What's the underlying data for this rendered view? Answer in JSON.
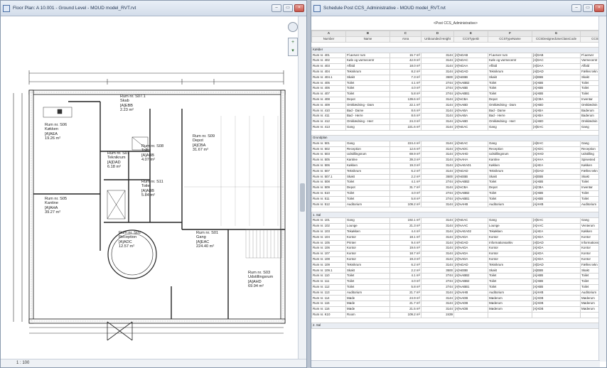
{
  "left_window": {
    "title": "Floor Plan: A 10.001 - Ground Level - MOUD model_RVT.rvt",
    "status_text": "1 : 100"
  },
  "right_window": {
    "title": "Schedule Post CCS_Administrative - MOUD model_RVT.rvt"
  },
  "window_buttons": {
    "minimize": "–",
    "restore": "▭",
    "close": "×"
  },
  "floor_plan": {
    "rooms": [
      {
        "label": "Rum nr. S07.1\nSkab\n[A]EBB\n2.23 m²"
      },
      {
        "label": "Rum nr. S06\nKøkken\n[A]AEA\n19.26 m²"
      },
      {
        "label": "Rum nr. S07\nTeknikrum\n[A]DAD\n6.18 m²"
      },
      {
        "label": "Rum nr. S08\nToilet\n[A]ABB\n4.07 m²"
      },
      {
        "label": "Rum nr. S11\nToilet\n[A]ABB\n5.84 m²"
      },
      {
        "label": "Rum nr. S09\nDepot\n[A]CBA\n31.67 m²"
      },
      {
        "label": "Rum nr. S05\nKantine\n[A]AHA\n39.27 m²"
      },
      {
        "label": "Rum nr. S02\nReception\n[A]ADC\n12.57 m²"
      },
      {
        "label": "Rum nr. S01\nGang\n[A]EAC\n224.40 m²"
      },
      {
        "label": "Rum nr. S03\nUdstillingsrum\n[A]AHD\n69.94 m²"
      }
    ]
  },
  "schedule": {
    "title": "<Post CCS_Administrative>",
    "column_letters": [
      "A",
      "B",
      "C",
      "D",
      "E",
      "F",
      "G",
      "H"
    ],
    "column_headers": [
      "Number",
      "Name",
      "Area",
      "Unbounded Height",
      "CCSTypeID",
      "CCSTypeName",
      "CCSDesignedUseClassCode",
      "CCSDesignedUse"
    ],
    "groups": [
      {
        "name": "Kælder",
        "rows": [
          [
            "Rum nr. 401",
            "Fl.aerver rum",
            "15.7 m²",
            "3144",
            "[A]%DAB",
            "Fl.aerver rum",
            "[A]DAB",
            "Fl.aerver"
          ],
          [
            "Rum nr. 402",
            "Køle og varmecentr",
            "42.9 m²",
            "3144",
            "[A]%DAC",
            "Køle og varmecentr",
            "[A]DAC",
            "Varmecentr"
          ],
          [
            "Rum nr. 403",
            "Affald",
            "18.0 m²",
            "3144",
            "[A]%DAA",
            "Affald",
            "[A]DAA",
            "Affald"
          ],
          [
            "Rum nr. 404",
            "Teknikrum",
            "8.2 m²",
            "3144",
            "[A]%DAD",
            "Teknikrum",
            "[A]DAD",
            "Fælles tekn"
          ],
          [
            "Rum nr. 404.1",
            "Skakt",
            "7.3 m²",
            "3500",
            "[A]%EBB",
            "Skakt",
            "[A]EBB",
            "Skakt"
          ],
          [
            "Rum nr. 405",
            "Toilet",
            "4.1 m²",
            "2744",
            "[A]%ABB2",
            "Toilet",
            "[A]ABB",
            "Toilet"
          ],
          [
            "Rum nr. 406",
            "Toilet",
            "4.0 m²",
            "2744",
            "[A]%ABB",
            "Toilet",
            "[A]ABB",
            "Toilet"
          ],
          [
            "Rum nr. 407",
            "Toilet",
            "5.8 m²",
            "2744",
            "[A]%ABB1",
            "Toilet",
            "[A]ABB",
            "Toilet"
          ],
          [
            "Rum nr. 408",
            "Depot",
            "139.6 m²",
            "3144",
            "[A]%CBA",
            "Depot",
            "[A]CBA",
            "Inventar"
          ],
          [
            "Rum nr. 409",
            "Omklædning - Dam",
            "22.1 m²",
            "3144",
            "[A]%ABD",
            "Omklædning - Dam",
            "[A]ABD",
            "Omklædnin"
          ],
          [
            "Rum nr. 410",
            "Bad - Dame",
            "8.6 m²",
            "3144",
            "[A]%ABA",
            "Bad - Dame",
            "[A]ABA",
            "Baderum"
          ],
          [
            "Rum nr. 411",
            "Bad - Herre",
            "8.6 m²",
            "3144",
            "[A]%ABA",
            "Bad - Herre",
            "[A]ABA",
            "Baderum"
          ],
          [
            "Rum nr. 412",
            "Omklædning - Herr",
            "24.3 m²",
            "3144",
            "[A]%ABD",
            "Omklædning - Herr",
            "[A]ABD",
            "Omklædnin"
          ],
          [
            "Rum nr. 413",
            "Gang",
            "221.6 m²",
            "3144",
            "[A]%EAC",
            "Gang",
            "[A]EAC",
            "Gang"
          ]
        ]
      },
      {
        "name": "Grundplan",
        "rows": [
          [
            "Rum nr. 501",
            "Gang",
            "224.4 m²",
            "3144",
            "[A]%EAC",
            "Gang",
            "[A]EAC",
            "Gang"
          ],
          [
            "Rum nr. 502",
            "Reception",
            "12.6 m²",
            "3144",
            "[A]%ADC",
            "Reception",
            "[A]ADC",
            "Reception"
          ],
          [
            "Rum nr. 503",
            "Udstillingsrum",
            "69.9 m²",
            "3144",
            "[A]%AHD",
            "Udstillingsrum",
            "[A]AHD",
            "Udstilling"
          ],
          [
            "Rum nr. 505",
            "Kantine",
            "39.3 m²",
            "3144",
            "[A]%AHA",
            "Kantine",
            "[A]AHA",
            "Spisested"
          ],
          [
            "Rum nr. 506",
            "Køkken",
            "19.3 m²",
            "3144",
            "[A]%AEA01",
            "Køkken",
            "[A]AEA",
            "Køkken"
          ],
          [
            "Rum nr. 507",
            "Teknikrum",
            "6.2 m²",
            "3144",
            "[A]%DAD",
            "Teknikrum",
            "[A]DAD",
            "Fælles tekn"
          ],
          [
            "Rum nr. 507.1",
            "Skakt",
            "2.2 m²",
            "3500",
            "[A]%EBB",
            "Skakt",
            "[A]EBB",
            "Skakt"
          ],
          [
            "Rum nr. 508",
            "Toilet",
            "4.1 m²",
            "2744",
            "[A]%ABB2",
            "Toilet",
            "[A]ABB",
            "Toilet"
          ],
          [
            "Rum nr. 509",
            "Depot",
            "31.7 m²",
            "3144",
            "[A]%CBA",
            "Depot",
            "[A]CBA",
            "Inventar"
          ],
          [
            "Rum nr. 510",
            "Toilet",
            "4.0 m²",
            "2744",
            "[A]%ABB2",
            "Toilet",
            "[A]ABB",
            "Toilet"
          ],
          [
            "Rum nr. 511",
            "Toilet",
            "5.8 m²",
            "2744",
            "[A]%ABB1",
            "Toilet",
            "[A]ABB",
            "Toilet"
          ],
          [
            "Rum nr. 512",
            "Auditorium",
            "109.2 m²",
            "3144",
            "[A]%AHB",
            "Auditorium",
            "[A]AHB",
            "Auditorium"
          ]
        ]
      },
      {
        "name": "1. Sal",
        "rows": [
          [
            "Rum nr. 101",
            "Gang",
            "192.1 m²",
            "3144",
            "[A]%EAC",
            "Gang",
            "[A]EAC",
            "Gang"
          ],
          [
            "Rum nr. 102",
            "Lounge",
            "21.3 m²",
            "3144",
            "[A]%AAC",
            "Lounge",
            "[A]AAC",
            "Venterum"
          ],
          [
            "Rum nr. 103",
            "Tekøkken",
            "4.4 m²",
            "3144",
            "[A]%AEA02",
            "Tekøkken",
            "[A]AEA",
            "Køkken"
          ],
          [
            "Rum nr. 104",
            "Kontor",
            "18.1 m²",
            "3144",
            "[A]%ADA",
            "Kontor",
            "[A]ADA",
            "Kontor"
          ],
          [
            "Rum nr. 105",
            "Printer",
            "9.4 m²",
            "3144",
            "[A]%DAD",
            "Informationsarkiv",
            "[A]DAD",
            "Informations"
          ],
          [
            "Rum nr. 106",
            "Kontor",
            "19.6 m²",
            "3144",
            "[A]%ADA",
            "Kontor",
            "[A]ADA",
            "Kontor"
          ],
          [
            "Rum nr. 107",
            "Kontor",
            "18.7 m²",
            "3144",
            "[A]%ADA",
            "Kontor",
            "[A]ADA",
            "Kontor"
          ],
          [
            "Rum nr. 108",
            "Kontor",
            "19.3 m²",
            "3144",
            "[A]%ADA",
            "Kontor",
            "[A]ADA",
            "Kontor"
          ],
          [
            "Rum nr. 109",
            "Teknikrum",
            "6.2 m²",
            "3144",
            "[A]%DAD",
            "Teknikrum",
            "[A]DAD",
            "Fælles tekn"
          ],
          [
            "Rum nr. 109.1",
            "Skakt",
            "2.2 m²",
            "3500",
            "[A]%EBB",
            "Skakt",
            "[A]EBB",
            "Skakt"
          ],
          [
            "Rum nr. 110",
            "Toilet",
            "4.1 m²",
            "2744",
            "[A]%ABB2",
            "Toilet",
            "[A]ABB",
            "Toilet"
          ],
          [
            "Rum nr. 111",
            "Toilet",
            "4.0 m²",
            "2744",
            "[A]%ABB2",
            "Toilet",
            "[A]ABB",
            "Toilet"
          ],
          [
            "Rum nr. 112",
            "Toilet",
            "5.8 m²",
            "2744",
            "[A]%ABB1",
            "Toilet",
            "[A]ABB",
            "Toilet"
          ],
          [
            "Rum nr. 113",
            "Auditorium",
            "21.7 m²",
            "3144",
            "[A]%AHB",
            "Auditorium",
            "[A]AHB",
            "Auditorium"
          ],
          [
            "Rum nr. 114",
            "Møde",
            "24.9 m²",
            "3144",
            "[A]%ADB",
            "Møderum",
            "[A]ADB",
            "Møderum"
          ],
          [
            "Rum nr. 115",
            "Møde",
            "21.7 m²",
            "3144",
            "[A]%ADB",
            "Møderum",
            "[A]ADB",
            "Møderum"
          ],
          [
            "Rum nr. 116",
            "Møde",
            "21.5 m²",
            "3144",
            "[A]%ADB",
            "Møderum",
            "[A]ADB",
            "Møderum"
          ],
          [
            "Rum nr. K10",
            "Room",
            "109.2 m²",
            "2439",
            "",
            "",
            "",
            ""
          ]
        ]
      },
      {
        "name": "2. Sal",
        "rows": []
      }
    ]
  }
}
